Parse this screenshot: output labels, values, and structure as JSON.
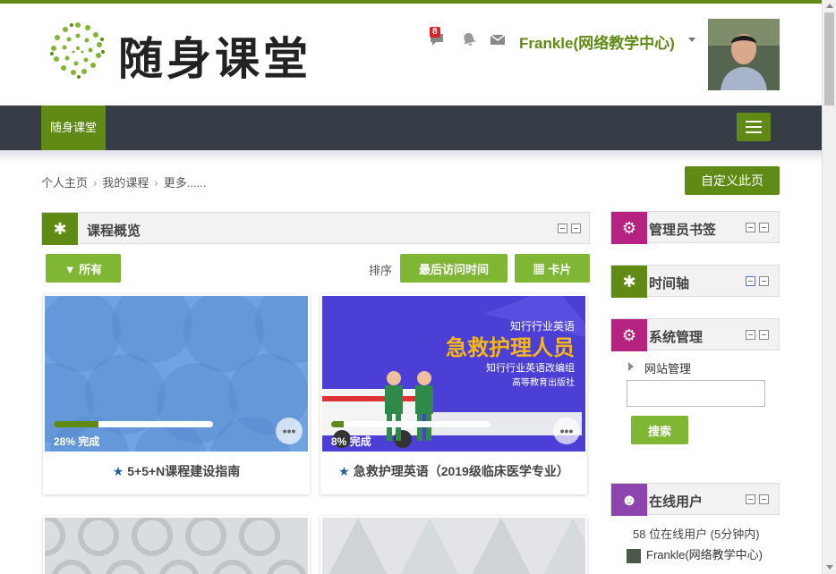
{
  "header": {
    "logo_text": "随身课堂",
    "message_badge": "8",
    "user_name": "Frankle(网络教学中心)"
  },
  "navbar": {
    "brand": "随身课堂"
  },
  "breadcrumb": [
    "个人主页",
    "我的课程",
    "更多......"
  ],
  "customize_button": "自定义此页",
  "course_overview": {
    "title": "课程概览",
    "filter_label": "所有",
    "sort_label": "排序",
    "sort_button": "最后访问时间",
    "view_button": "卡片",
    "courses": [
      {
        "title": "5+5+N课程建设指南",
        "progress": 28,
        "progress_text": "28% 完成"
      },
      {
        "title": "急救护理英语（2019级临床医学专业）",
        "progress": 8,
        "progress_text": "8% 完成",
        "banner_line1": "知行行业英语",
        "banner_title": "急救护理人员",
        "banner_line2": "知行行业英语改编组",
        "banner_line3": "高等教育出版社"
      }
    ]
  },
  "sidebar": {
    "admin_bookmarks": {
      "title": "管理员书签"
    },
    "timeline": {
      "title": "时间轴"
    },
    "site_admin": {
      "title": "系统管理",
      "link": "网站管理",
      "search_button": "搜索"
    },
    "online_users": {
      "title": "在线用户",
      "count_text": "58 位在线用户 (5分钟内)",
      "user": "Frankle(网络教学中心)"
    }
  },
  "colors": {
    "brand_green": "#5f8a14",
    "light_green": "#7fb734",
    "nav_dark": "#373d47",
    "magenta": "#b5227f",
    "purple": "#8e44ad"
  }
}
